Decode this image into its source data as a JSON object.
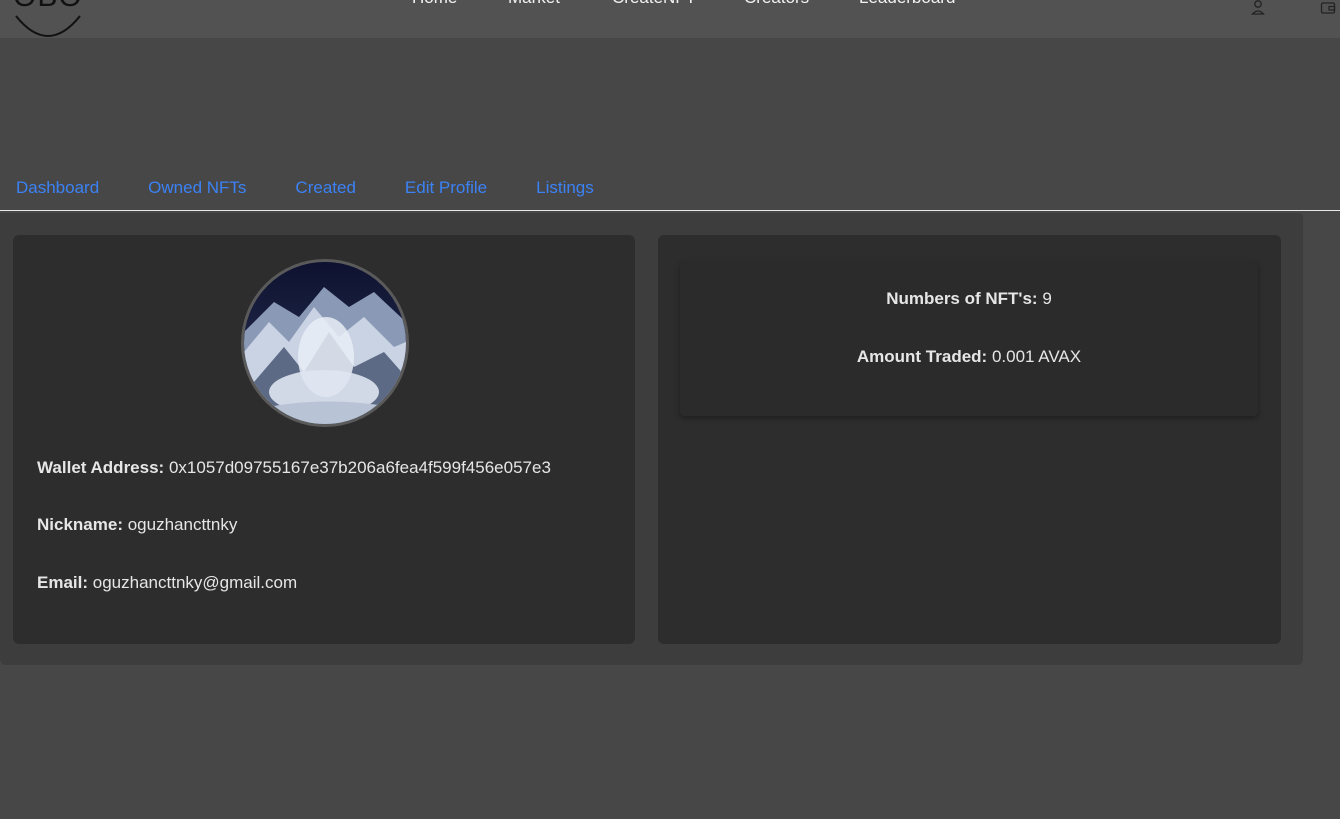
{
  "header": {
    "logo_text": "OBO",
    "nav": [
      "Home",
      "Market",
      "CreateNFT",
      "Creators",
      "Leaderboard"
    ]
  },
  "tabs": [
    "Dashboard",
    "Owned NFTs",
    "Created",
    "Edit Profile",
    "Listings"
  ],
  "profile": {
    "wallet_label": "Wallet Address:",
    "wallet_value": "0x1057d09755167e37b206a6fea4f599f456e057e3",
    "nickname_label": "Nickname:",
    "nickname_value": "oguzhancttnky",
    "email_label": "Email:",
    "email_value": "oguzhancttnky@gmail.com"
  },
  "stats": {
    "nfts_label": "Numbers of NFT's:",
    "nfts_value": "9",
    "traded_label": "Amount Traded:",
    "traded_value": "0.001 AVAX"
  },
  "colors": {
    "page_bg": "#474747",
    "header_bg": "#525252",
    "tab_link": "#3b82f6",
    "card_bg": "#2d2d2d"
  },
  "icons": [
    "user-icon",
    "wallet-icon"
  ]
}
